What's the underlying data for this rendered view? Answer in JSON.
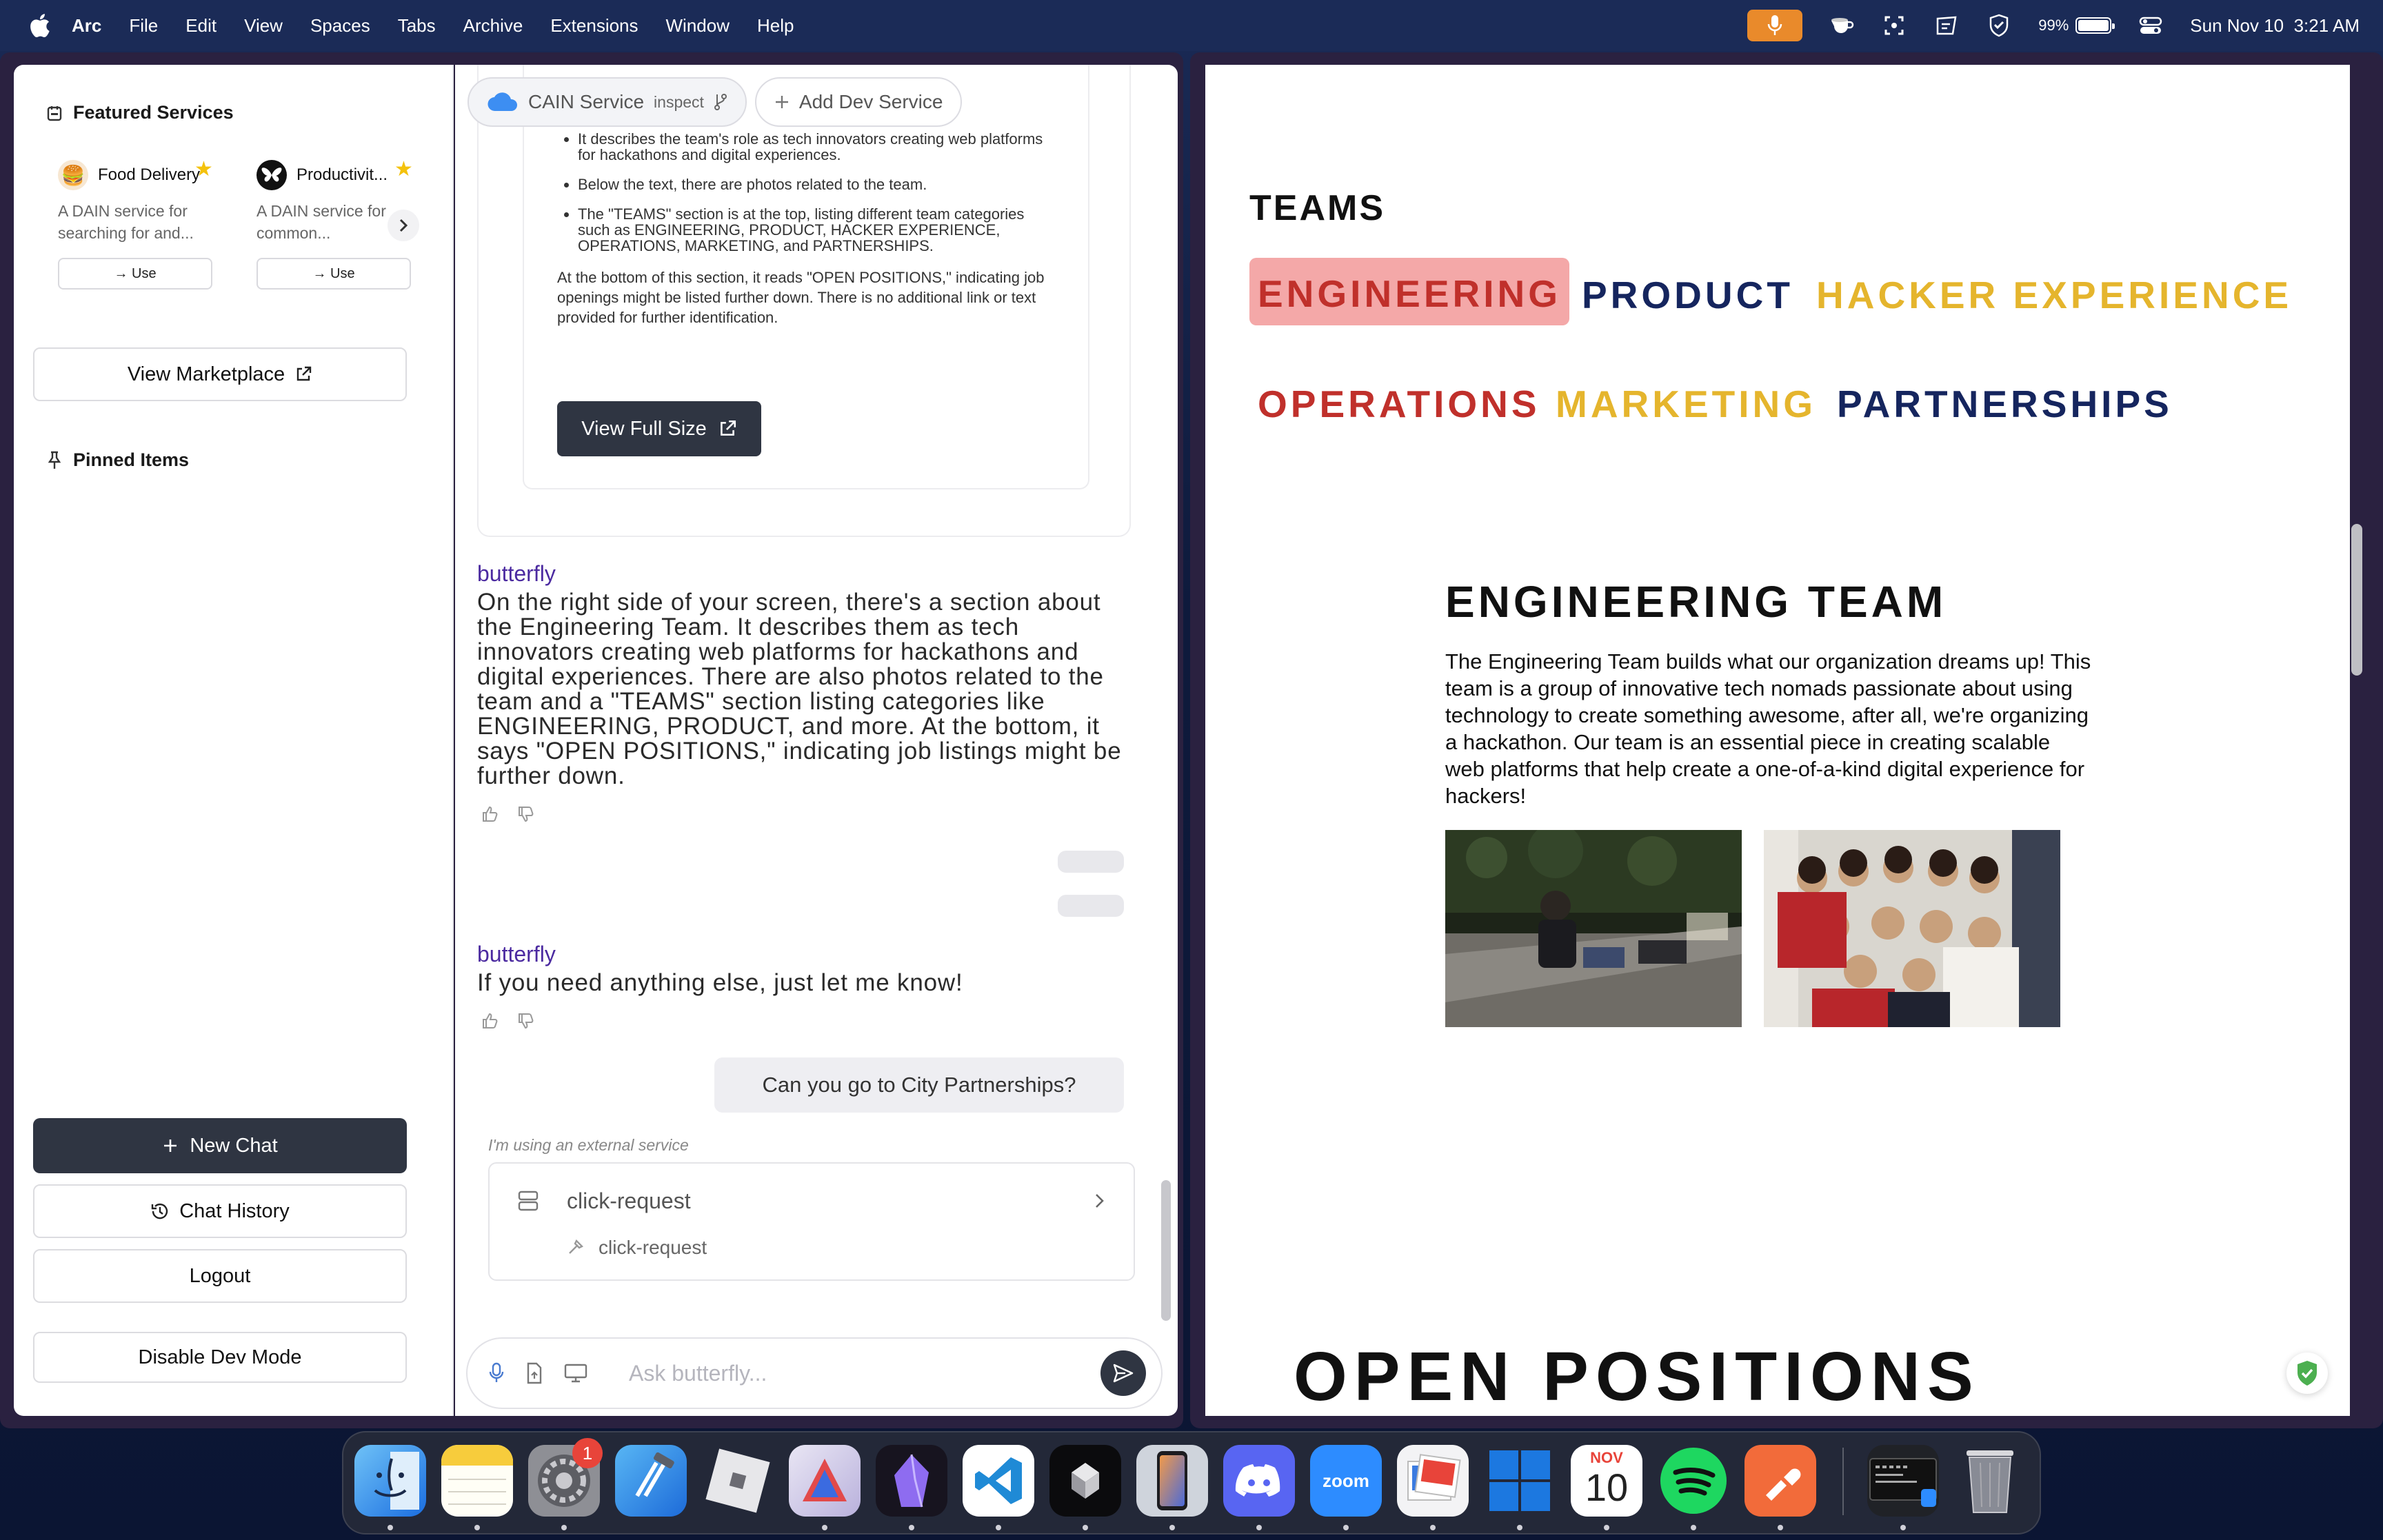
{
  "menubar": {
    "app": "Arc",
    "items": [
      "File",
      "Edit",
      "View",
      "Spaces",
      "Tabs",
      "Archive",
      "Extensions",
      "Window",
      "Help"
    ],
    "battery": "99%",
    "battery_level": 0.99,
    "datetime": "Sun Nov 10  3:21 AM"
  },
  "sidebar": {
    "featured_title": "Featured Services",
    "services": [
      {
        "name": "Food Delivery",
        "desc": "A DAIN service for searching for and...",
        "use_label": "→ Use"
      },
      {
        "name": "Productivit...",
        "desc": "A DAIN service for common...",
        "use_label": "→ Use"
      }
    ],
    "view_marketplace": "View Marketplace",
    "pinned_title": "Pinned Items",
    "new_chat": "New Chat",
    "chat_history": "Chat History",
    "logout": "Logout",
    "disable_dev": "Disable Dev Mode"
  },
  "chat": {
    "service_tab": "CAIN Service",
    "service_tab_sub": "inspect",
    "add_dev_service": "Add Dev Service",
    "tool_bullets": [
      "It describes the team's role as tech innovators creating web platforms for hackathons and digital experiences.",
      "Below the text, there are photos related to the team.",
      "The \"TEAMS\" section is at the top, listing different team categories such as ENGINEERING, PRODUCT, HACKER EXPERIENCE, OPERATIONS, MARKETING, and PARTNERSHIPS."
    ],
    "tool_footer": "At the bottom of this section, it reads \"OPEN POSITIONS,\" indicating job openings might be listed further down. There is no additional link or text provided for further identification.",
    "view_full_size": "View Full Size",
    "messages": [
      {
        "sender": "butterfly",
        "text": "On the right side of your screen, there's a section about the Engineering Team. It describes them as tech innovators creating web platforms for hackathons and digital experiences. There are also photos related to the team and a \"TEAMS\" section listing categories like ENGINEERING, PRODUCT, and more. At the bottom, it says \"OPEN POSITIONS,\" indicating job listings might be further down."
      },
      {
        "sender": "butterfly",
        "text": "If you need anything else, just let me know!"
      }
    ],
    "user_message": "Can you go to City Partnerships?",
    "external_note": "I'm using an external service",
    "ext_title": "click-request",
    "ext_sub": "click-request",
    "input_placeholder": "Ask butterfly..."
  },
  "webpage": {
    "teams_label": "TEAMS",
    "tabs": [
      {
        "label": "ENGINEERING",
        "color": "#c0302b",
        "active": true
      },
      {
        "label": "PRODUCT",
        "color": "#15255e",
        "active": false
      },
      {
        "label": "HACKER EXPERIENCE",
        "color": "#e5b52d",
        "active": false
      },
      {
        "label": "OPERATIONS",
        "color": "#c0302b",
        "active": false
      },
      {
        "label": "MARKETING",
        "color": "#e5b52d",
        "active": false
      },
      {
        "label": "PARTNERSHIPS",
        "color": "#15255e",
        "active": false
      }
    ],
    "eng_title": "ENGINEERING TEAM",
    "eng_body": "The Engineering Team builds what our organization dreams up! This team is a group of innovative tech nomads passionate about using technology to create something awesome, after all, we're organizing a hackathon. Our team is an essential piece in creating scalable web platforms that help create a one-of-a-kind digital experience for hackers!",
    "open_positions": "OPEN POSITIONS"
  },
  "dock": {
    "apps": [
      "Finder",
      "Notes",
      "System Settings",
      "Xcode",
      "Roblox",
      "Affinity",
      "Obsidian",
      "Visual Studio Code",
      "Warp",
      "Simulator",
      "Discord",
      "Zoom",
      "Preview",
      "Windows App",
      "Calendar",
      "Spotify",
      "Postman",
      "Terminal",
      "Trash"
    ],
    "settings_badge": "1",
    "calendar_month": "NOV",
    "calendar_day": "10",
    "zoom_label": "zoom"
  },
  "colors": {
    "accent_dark": "#2f3542",
    "sender_purple": "#4b2aa0",
    "active_tab_bg": "#f4a8a8"
  }
}
